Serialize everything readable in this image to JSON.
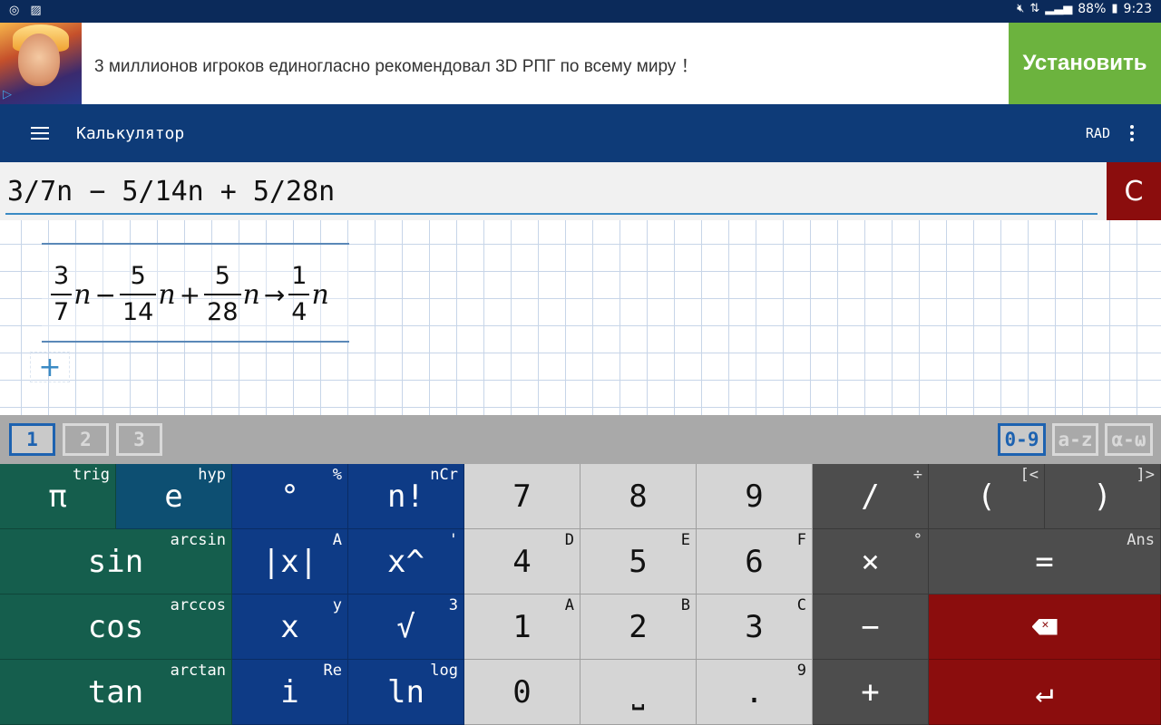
{
  "status_bar": {
    "left_icons": [
      "target-icon",
      "image-icon"
    ],
    "battery": "88%",
    "time": "9:23"
  },
  "ad": {
    "text": "3 миллионов игроков единогласно рекомендовал 3D РПГ по всему миру ！",
    "install_label": "Установить"
  },
  "app_bar": {
    "title": "Калькулятор",
    "mode": "RAD"
  },
  "input": {
    "expression": "3/7n − 5/14n + 5/28n",
    "clear_label": "C"
  },
  "result": {
    "terms": [
      {
        "num": "3",
        "den": "7",
        "var": "n",
        "op_after": "−"
      },
      {
        "num": "5",
        "den": "14",
        "var": "n",
        "op_after": "+"
      },
      {
        "num": "5",
        "den": "28",
        "var": "n",
        "op_after": "→"
      },
      {
        "num": "1",
        "den": "4",
        "var": "n",
        "op_after": ""
      }
    ],
    "add_label": "+"
  },
  "tabs": {
    "pages": [
      "1",
      "2",
      "3"
    ],
    "active_page": "1",
    "modes": [
      "0-9",
      "a-z",
      "α-ω"
    ],
    "active_mode": "0-9"
  },
  "keys": {
    "pi": {
      "main": "π",
      "sub": "trig"
    },
    "e": {
      "main": "e",
      "sub": "hyp"
    },
    "degree": {
      "main": "°",
      "sub": "%"
    },
    "factorial": {
      "main": "n!",
      "sub": "nCr"
    },
    "seven": {
      "main": "7",
      "sub": ""
    },
    "eight": {
      "main": "8",
      "sub": ""
    },
    "nine": {
      "main": "9",
      "sub": ""
    },
    "divide": {
      "main": "/",
      "sub": "÷"
    },
    "lparen": {
      "main": "(",
      "sub": "[<"
    },
    "rparen": {
      "main": ")",
      "sub": "]>"
    },
    "sin": {
      "main": "sin",
      "sub": "arcsin"
    },
    "abs": {
      "main": "|x|",
      "sub": "A"
    },
    "power": {
      "main": "x^",
      "sub": "'"
    },
    "four": {
      "main": "4",
      "sub": "D"
    },
    "five": {
      "main": "5",
      "sub": "E"
    },
    "six": {
      "main": "6",
      "sub": "F"
    },
    "multiply": {
      "main": "×",
      "sub": "°"
    },
    "equals": {
      "main": "=",
      "sub": "Ans"
    },
    "cos": {
      "main": "cos",
      "sub": "arccos"
    },
    "x": {
      "main": "x",
      "sub": "y"
    },
    "sqrt": {
      "main": "√",
      "sub": "3"
    },
    "one": {
      "main": "1",
      "sub": "A"
    },
    "two": {
      "main": "2",
      "sub": "B"
    },
    "three": {
      "main": "3",
      "sub": "C"
    },
    "minus": {
      "main": "−",
      "sub": ""
    },
    "tan": {
      "main": "tan",
      "sub": "arctan"
    },
    "i": {
      "main": "i",
      "sub": "Re"
    },
    "ln": {
      "main": "ln",
      "sub": "log"
    },
    "zero": {
      "main": "0",
      "sub": ""
    },
    "space": {
      "main": "⎵",
      "sub": ""
    },
    "dot": {
      "main": ".",
      "sub": "9"
    },
    "plus": {
      "main": "+",
      "sub": ""
    },
    "enter": {
      "main": "↵",
      "sub": ""
    }
  },
  "colors": {
    "status_bar": "#0b2a5a",
    "app_bar": "#0e3b78",
    "install_button": "#6cb33e",
    "clear_button": "#8b0d0d",
    "key_green": "#155e4d",
    "key_teal": "#0d4f72",
    "key_blue": "#0e3b86",
    "key_gray": "#d5d5d5",
    "key_dark": "#4d4d4d",
    "key_red": "#8b0d0d",
    "accent": "#1d62b0"
  }
}
